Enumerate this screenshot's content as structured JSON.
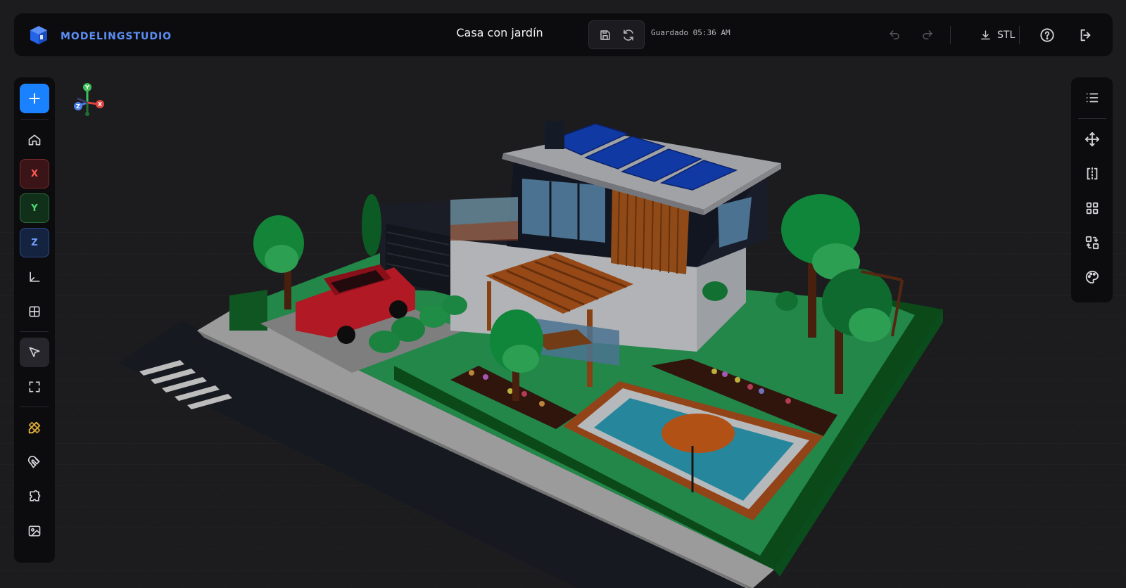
{
  "app": {
    "brand": "MODELINGSTUDIO",
    "doc_title": "Casa con jardín",
    "save_status": "Guardado 05:36 AM",
    "export_label": "STL"
  },
  "gizmo": {
    "y": "Y",
    "x": "X",
    "z": "Z"
  },
  "left_toolbar": {
    "axis_x": "X",
    "axis_y": "Y",
    "axis_z": "Z"
  },
  "icons": {
    "brand": "cube-logo-icon",
    "save": "save-icon",
    "sync": "refresh-icon",
    "undo": "undo-icon",
    "redo": "redo-icon",
    "download": "download-icon",
    "help": "help-icon",
    "exit": "logout-icon"
  },
  "colors": {
    "accent": "#1a82ff",
    "axis_x": "#e0443f",
    "axis_y": "#3fbf5a",
    "axis_z": "#4d7fe6",
    "highlight": "#e8b43a"
  }
}
